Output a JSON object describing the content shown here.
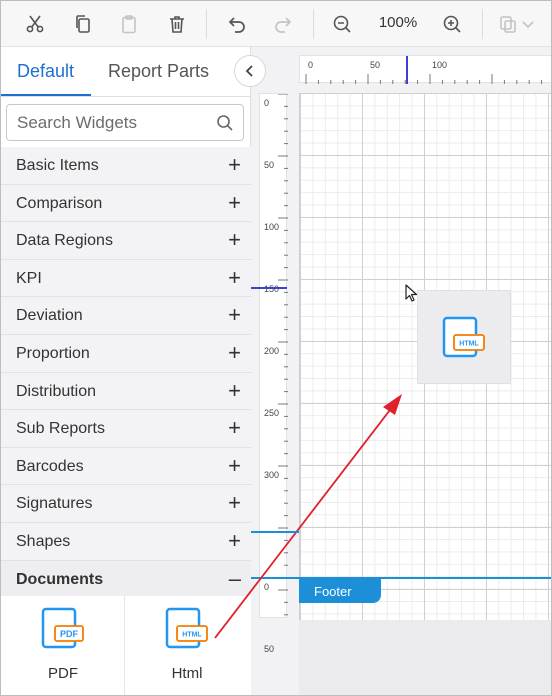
{
  "toolbar": {
    "zoom_level": "100%",
    "buttons": [
      "cut-icon",
      "copy-icon",
      "paste-icon",
      "delete-icon",
      "undo-icon",
      "redo-icon",
      "zoom-out-icon",
      "zoom-in-icon",
      "preview-icon",
      "chevron-down-icon"
    ]
  },
  "panel": {
    "tabs": [
      {
        "label": "Default",
        "active": true
      },
      {
        "label": "Report Parts",
        "active": false
      }
    ],
    "search": {
      "placeholder": "Search Widgets"
    },
    "categories": [
      {
        "label": "Basic Items",
        "sign": "+"
      },
      {
        "label": "Comparison",
        "sign": "+"
      },
      {
        "label": "Data Regions",
        "sign": "+"
      },
      {
        "label": "KPI",
        "sign": "+"
      },
      {
        "label": "Deviation",
        "sign": "+"
      },
      {
        "label": "Proportion",
        "sign": "+"
      },
      {
        "label": "Distribution",
        "sign": "+"
      },
      {
        "label": "Sub Reports",
        "sign": "+"
      },
      {
        "label": "Barcodes",
        "sign": "+"
      },
      {
        "label": "Signatures",
        "sign": "+"
      },
      {
        "label": "Shapes",
        "sign": "+"
      },
      {
        "label": "Documents",
        "sign": "–"
      }
    ],
    "documents": [
      {
        "label": "PDF",
        "icon_text": "PDF"
      },
      {
        "label": "Html",
        "icon_text": "HTML"
      }
    ]
  },
  "design": {
    "hruler_labels": [
      "0",
      "50",
      "100"
    ],
    "vruler_labels": [
      "0",
      "50",
      "100",
      "150",
      "200",
      "250",
      "300"
    ],
    "vruler_footer_labels": [
      "0",
      "50"
    ],
    "footer_label": "Footer",
    "drop_icon_text": "HTML"
  },
  "colors": {
    "accent": "#1f6fd1",
    "icon_blue": "#2196f3",
    "icon_orange": "#f57c00",
    "footer": "#1c8fd8",
    "arrow": "#e0202a"
  }
}
